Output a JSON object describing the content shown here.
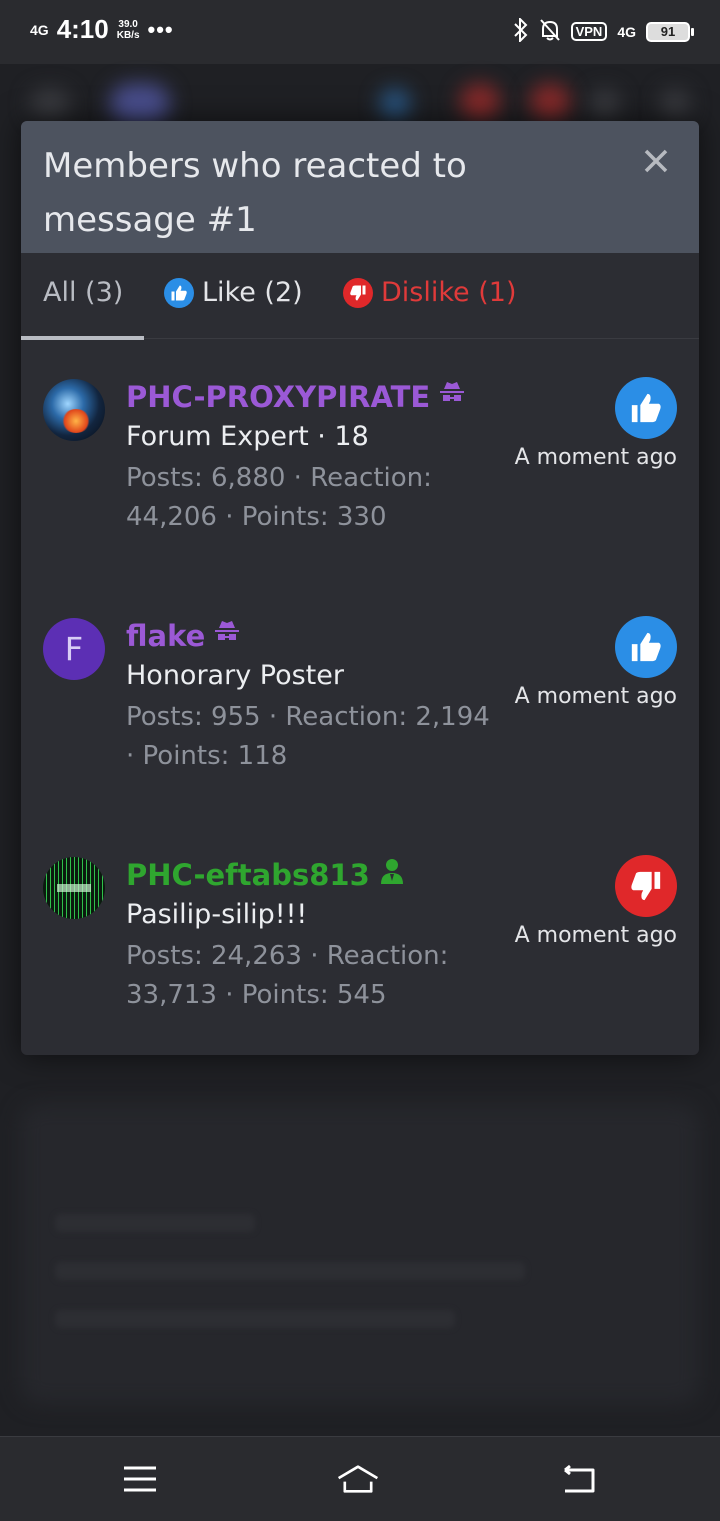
{
  "status_bar": {
    "network": "4G",
    "time": "4:10",
    "speed_value": "39.0",
    "speed_unit": "KB/s",
    "more": "•••",
    "vpn": "VPN",
    "network_right": "4G",
    "battery": "91"
  },
  "modal": {
    "title": "Members who reacted to message #1",
    "close_icon": "close-icon",
    "tabs": [
      {
        "label": "All (3)",
        "active": true
      },
      {
        "label": "Like (2)",
        "icon": "thumbs-up-icon",
        "color": "#2b8ee6"
      },
      {
        "label": "Dislike (1)",
        "icon": "thumbs-down-icon",
        "color": "#e0282a"
      }
    ],
    "members": [
      {
        "name": "PHC-PROXYPIRATE",
        "name_color": "#9b59d6",
        "title": "Forum Expert · 18",
        "stats": "Posts: 6,880 · Reaction: 44,206 · Points: 330",
        "reaction": "like",
        "time": "A moment ago"
      },
      {
        "name": "flake",
        "name_color": "#9b59d6",
        "avatar_letter": "F",
        "title": "Honorary Poster",
        "stats": "Posts: 955 · Reaction: 2,194 · Points: 118",
        "reaction": "like",
        "time": "A moment ago"
      },
      {
        "name": "PHC-eftabs813",
        "name_color": "#2fa62f",
        "title": "Pasilip-silip!!!",
        "stats": "Posts: 24,263 · Reaction: 33,713 · Points: 545",
        "reaction": "dislike",
        "time": "A moment ago"
      }
    ]
  },
  "colors": {
    "like": "#2b8ee6",
    "dislike": "#e0282a",
    "header_bg": "#4d535f",
    "modal_bg": "#2c2d33"
  }
}
